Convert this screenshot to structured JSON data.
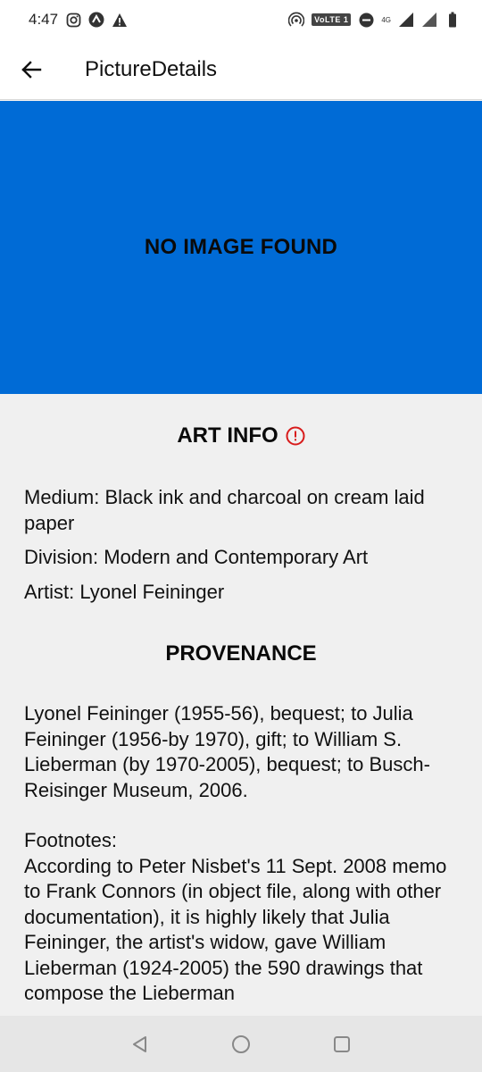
{
  "status_bar": {
    "time": "4:47",
    "volte": "VoLTE 1",
    "network": "4G"
  },
  "app_bar": {
    "title": "PictureDetails"
  },
  "image": {
    "placeholder_text": "NO IMAGE FOUND",
    "background_color": "#006bd6"
  },
  "art_info": {
    "heading": "ART INFO",
    "medium": "Medium: Black ink and charcoal on cream laid paper",
    "division": "Division: Modern and Contemporary Art",
    "artist": "Artist: Lyonel Feininger"
  },
  "provenance": {
    "heading": "PROVENANCE",
    "text": "Lyonel Feininger (1955-56), bequest; to Julia Feininger (1956-by 1970), gift; to William S. Lieberman (by 1970-2005), bequest; to Busch-Reisinger Museum, 2006.",
    "footnotes_label": "Footnotes:",
    "footnotes_text": "According to Peter Nisbet's 11 Sept. 2008 memo to Frank Connors (in object file, along with other documentation), it is highly likely that Julia Feininger, the artist's widow, gave William Lieberman (1924-2005) the 590 drawings that compose the Lieberman"
  },
  "colors": {
    "alert_icon": "#d81b1b",
    "nav_bar": "#e6e6e6"
  }
}
